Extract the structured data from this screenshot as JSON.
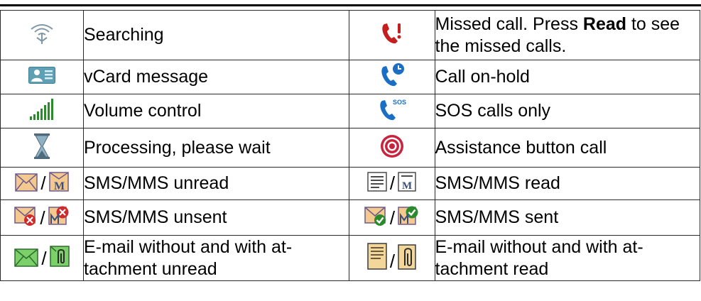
{
  "rows": [
    {
      "left": {
        "text": "Searching",
        "icon": "antenna-searching-icon"
      },
      "right": {
        "text_before": "Missed call. Press ",
        "text_bold": "Read",
        "text_after": " to see the missed calls.",
        "icon": "missed-call-icon"
      }
    },
    {
      "left": {
        "text": "vCard message",
        "icon": "vcard-icon"
      },
      "right": {
        "text": "Call on-hold",
        "icon": "call-on-hold-icon"
      }
    },
    {
      "left": {
        "text": "Volume control",
        "icon": "volume-bars-icon"
      },
      "right": {
        "text": "SOS calls only",
        "icon": "sos-call-icon",
        "icon_text": "SOS"
      }
    },
    {
      "left": {
        "text": "Processing, please wait",
        "icon": "hourglass-icon"
      },
      "right": {
        "text": "Assistance button call",
        "icon": "assistance-target-icon"
      }
    },
    {
      "left": {
        "text": "SMS/MMS unread",
        "icon": "sms-unread-icon",
        "icon2": "mms-unread-icon",
        "icon_text": "M"
      },
      "right": {
        "text": "SMS/MMS read",
        "icon": "sms-read-icon",
        "icon2": "mms-read-icon",
        "icon_text": "M"
      }
    },
    {
      "left": {
        "text": "SMS/MMS unsent",
        "icon": "sms-unsent-icon",
        "icon2": "mms-unsent-icon"
      },
      "right": {
        "text": "SMS/MMS sent",
        "icon": "sms-sent-icon",
        "icon2": "mms-sent-icon"
      }
    },
    {
      "left": {
        "text": "E-mail without and with at-tachment unread",
        "icon": "email-unread-icon",
        "icon2": "email-attachment-unread-icon"
      },
      "right": {
        "text": "E-mail without and with at-tachment read",
        "icon": "email-read-icon",
        "icon2": "email-attachment-read-icon"
      }
    }
  ],
  "separator": "/",
  "colors": {
    "phone_blue": "#1a6fc4",
    "missed_red": "#c41e1e",
    "envelope": "#f3c98f",
    "green": "#2b8a2b",
    "antenna": "#7f98a8"
  }
}
